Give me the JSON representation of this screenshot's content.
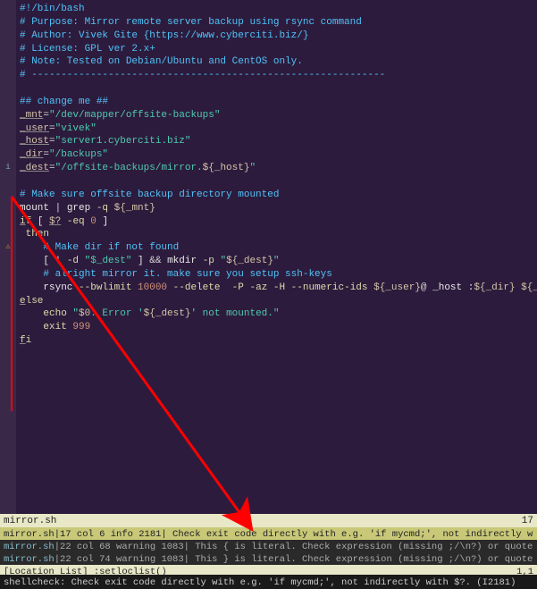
{
  "gutter": {
    "markers": {
      "13": "i",
      "19": "⚠"
    }
  },
  "code": [
    {
      "segs": [
        {
          "t": "#!/bin/bash",
          "c": "c-comment"
        }
      ]
    },
    {
      "segs": [
        {
          "t": "# Purpose: Mirror remote server backup using rsync command",
          "c": "c-comment"
        }
      ]
    },
    {
      "segs": [
        {
          "t": "# Author: Vivek Gite {https://www.cyberciti.biz/}",
          "c": "c-comment"
        }
      ]
    },
    {
      "segs": [
        {
          "t": "# License: GPL ver 2.x+",
          "c": "c-comment"
        }
      ]
    },
    {
      "segs": [
        {
          "t": "# Note: Tested on Debian/Ubuntu and CentOS only.",
          "c": "c-comment"
        }
      ]
    },
    {
      "segs": [
        {
          "t": "# ------------------------------------------------------------",
          "c": "c-comment"
        }
      ]
    },
    {
      "segs": [
        {
          "t": "",
          "c": "c-default"
        }
      ]
    },
    {
      "segs": [
        {
          "t": "## change me ##",
          "c": "c-comment"
        }
      ]
    },
    {
      "segs": [
        {
          "t": "_mnt",
          "c": "c-var c-under"
        },
        {
          "t": "=",
          "c": "c-op"
        },
        {
          "t": "\"/dev/mapper/offsite-backups\"",
          "c": "c-string"
        }
      ]
    },
    {
      "segs": [
        {
          "t": "_user",
          "c": "c-var c-under"
        },
        {
          "t": "=",
          "c": "c-op"
        },
        {
          "t": "\"vivek\"",
          "c": "c-string"
        }
      ]
    },
    {
      "segs": [
        {
          "t": "_host",
          "c": "c-var c-under"
        },
        {
          "t": "=",
          "c": "c-op"
        },
        {
          "t": "\"server1.cyberciti.biz\"",
          "c": "c-string"
        }
      ]
    },
    {
      "segs": [
        {
          "t": "_dir",
          "c": "c-var c-under"
        },
        {
          "t": "=",
          "c": "c-op"
        },
        {
          "t": "\"/backups\"",
          "c": "c-string"
        }
      ]
    },
    {
      "segs": [
        {
          "t": "_dest",
          "c": "c-var c-under"
        },
        {
          "t": "=",
          "c": "c-op"
        },
        {
          "t": "\"/offsite-backups/mirror.",
          "c": "c-string"
        },
        {
          "t": "${_host}",
          "c": "c-var"
        },
        {
          "t": "\"",
          "c": "c-string"
        }
      ]
    },
    {
      "segs": [
        {
          "t": "",
          "c": "c-default"
        }
      ]
    },
    {
      "segs": [
        {
          "t": "# Make sure offsite backup directory mounted",
          "c": "c-comment"
        }
      ]
    },
    {
      "segs": [
        {
          "t": "mount ",
          "c": "c-white"
        },
        {
          "t": "|",
          "c": "c-op"
        },
        {
          "t": " grep ",
          "c": "c-white"
        },
        {
          "t": "-q",
          "c": "c-yellow"
        },
        {
          "t": " ",
          "c": "c-default"
        },
        {
          "t": "${_mnt}",
          "c": "c-var"
        }
      ]
    },
    {
      "segs": [
        {
          "t": "i",
          "c": "c-yellow c-under"
        },
        {
          "t": "f",
          "c": "c-yellow"
        },
        {
          "t": " [ ",
          "c": "c-white"
        },
        {
          "t": "$?",
          "c": "c-var c-under"
        },
        {
          "t": " ",
          "c": "c-default"
        },
        {
          "t": "-eq",
          "c": "c-yellow"
        },
        {
          "t": " ",
          "c": "c-default"
        },
        {
          "t": "0",
          "c": "c-number"
        },
        {
          "t": " ]",
          "c": "c-white"
        }
      ]
    },
    {
      "segs": [
        {
          "t": " ",
          "c": "c-default"
        },
        {
          "t": "then",
          "c": "c-yellow"
        }
      ]
    },
    {
      "segs": [
        {
          "t": "    ",
          "c": "c-default"
        },
        {
          "t": "# Make dir if not found",
          "c": "c-comment"
        }
      ]
    },
    {
      "segs": [
        {
          "t": "    [ ",
          "c": "c-white"
        },
        {
          "t": "!",
          "c": "c-op"
        },
        {
          "t": " ",
          "c": "c-default"
        },
        {
          "t": "-d",
          "c": "c-yellow"
        },
        {
          "t": " ",
          "c": "c-default"
        },
        {
          "t": "\"$_dest\"",
          "c": "c-string"
        },
        {
          "t": " ] ",
          "c": "c-white"
        },
        {
          "t": "&&",
          "c": "c-op"
        },
        {
          "t": " mkdir ",
          "c": "c-white"
        },
        {
          "t": "-p",
          "c": "c-yellow"
        },
        {
          "t": " ",
          "c": "c-default"
        },
        {
          "t": "\"",
          "c": "c-string"
        },
        {
          "t": "${_dest}",
          "c": "c-var"
        },
        {
          "t": "\"",
          "c": "c-string"
        }
      ]
    },
    {
      "segs": [
        {
          "t": "    ",
          "c": "c-default"
        },
        {
          "t": "# alright mirror it. make sure you setup ssh-keys",
          "c": "c-comment"
        }
      ]
    },
    {
      "segs": [
        {
          "t": "    rsync ",
          "c": "c-white"
        },
        {
          "t": "--bwlimit ",
          "c": "c-yellow"
        },
        {
          "t": "10000",
          "c": "c-number"
        },
        {
          "t": " ",
          "c": "c-default"
        },
        {
          "t": "--delete  -P -az -H --numeric-ids ",
          "c": "c-yellow"
        },
        {
          "t": "${_user}",
          "c": "c-var"
        },
        {
          "t": "@",
          "c": "c-default"
        },
        {
          "t": " _host :",
          "c": "c-white"
        },
        {
          "t": "${_dir}",
          "c": "c-var"
        },
        {
          "t": " ",
          "c": "c-default"
        },
        {
          "t": "${_dest}",
          "c": "c-var"
        }
      ]
    },
    {
      "segs": [
        {
          "t": "e",
          "c": "c-yellow c-under"
        },
        {
          "t": "lse",
          "c": "c-yellow"
        }
      ]
    },
    {
      "segs": [
        {
          "t": "    ",
          "c": "c-default"
        },
        {
          "t": "echo",
          "c": "c-yellow"
        },
        {
          "t": " ",
          "c": "c-default"
        },
        {
          "t": "\"",
          "c": "c-string"
        },
        {
          "t": "$0",
          "c": "c-var"
        },
        {
          "t": ": Error '",
          "c": "c-string"
        },
        {
          "t": "${_dest}",
          "c": "c-var"
        },
        {
          "t": "' not mounted.\"",
          "c": "c-string"
        }
      ]
    },
    {
      "segs": [
        {
          "t": "    ",
          "c": "c-default"
        },
        {
          "t": "exit",
          "c": "c-yellow"
        },
        {
          "t": " ",
          "c": "c-default"
        },
        {
          "t": "999",
          "c": "c-number"
        }
      ]
    },
    {
      "segs": [
        {
          "t": "f",
          "c": "c-yellow c-under"
        },
        {
          "t": "i",
          "c": "c-yellow"
        }
      ]
    }
  ],
  "status": {
    "filename": "mirror.sh",
    "lineno": "17"
  },
  "warnings": [
    {
      "hl": true,
      "file": "mirror.sh",
      "loc": "17 col 6 info 2181",
      "msg": "Check exit code directly with e.g. 'if mycmd;', not indirectly w"
    },
    {
      "hl": false,
      "file": "mirror.sh",
      "loc": "22 col 68 warning 1083",
      "msg": "This { is literal. Check expression (missing ;/\\n?) or quote"
    },
    {
      "hl": false,
      "file": "mirror.sh",
      "loc": "22 col 74 warning 1083",
      "msg": "This } is literal. Check expression (missing ;/\\n?) or quote"
    }
  ],
  "loclist": {
    "left": "[Location List] :setloclist()",
    "right": "1,1"
  },
  "cmdline": "shellcheck: Check exit code directly with e.g. 'if mycmd;', not indirectly with $?. (I2181)"
}
